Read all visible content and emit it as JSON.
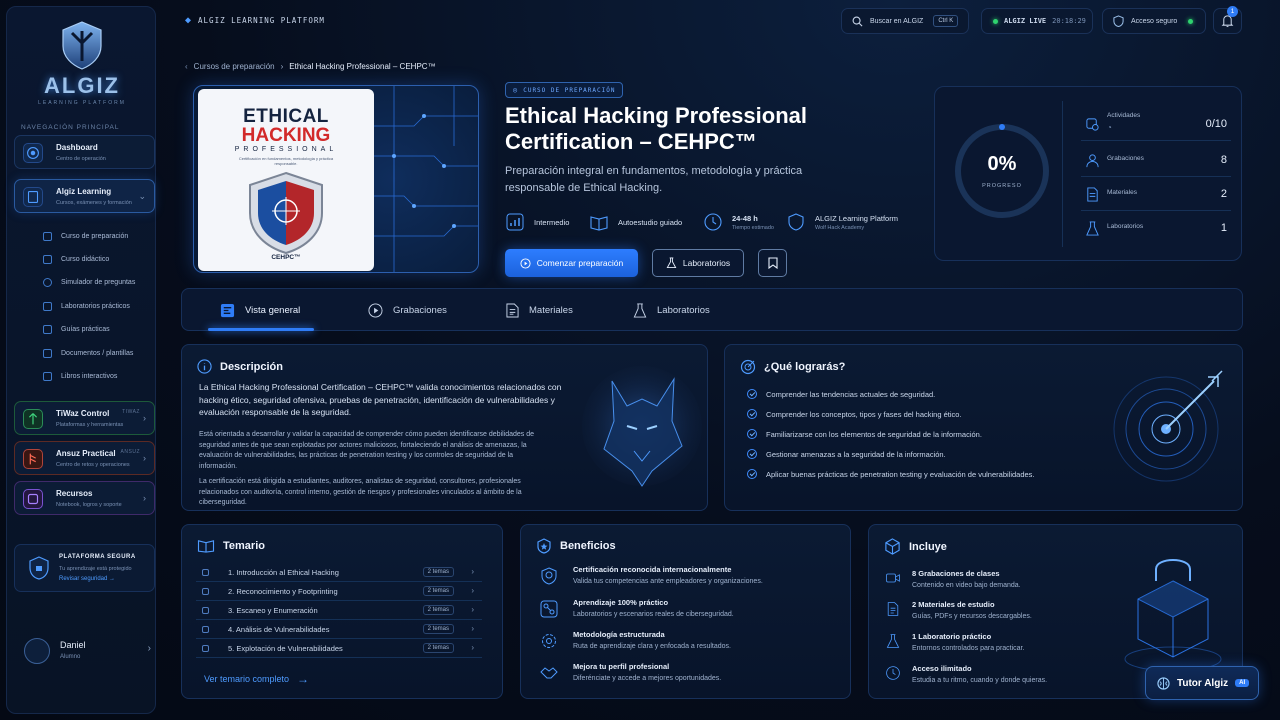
{
  "app": {
    "logo_text": "ALGIZ",
    "logo_sub": "LEARNING PLATFORM",
    "platform_label": "ALGIZ LEARNING PLATFORM"
  },
  "topbar": {
    "search_label": "Buscar en ALGIZ",
    "search_shortcut": "Ctrl K",
    "live_label": "ALGIZ LIVE",
    "live_time": "20:18:29",
    "secure_label": "Acceso seguro",
    "notifications_count": "1"
  },
  "sidebar": {
    "heading": "NAVEGACIÓN PRINCIPAL",
    "dashboard": {
      "title": "Dashboard",
      "subtitle": "Centro de operación"
    },
    "learning": {
      "title": "Algiz Learning",
      "subtitle": "Cursos, exámenes y formación"
    },
    "sub_items": [
      {
        "label": "Curso de preparación"
      },
      {
        "label": "Curso didáctico"
      },
      {
        "label": "Simulador de preguntas"
      },
      {
        "label": "Laboratorios prácticos"
      },
      {
        "label": "Guías prácticas"
      },
      {
        "label": "Documentos / plantillas"
      },
      {
        "label": "Libros interactivos"
      }
    ],
    "tiwaz": {
      "title": "TiWaz Control",
      "subtitle": "Plataformas y herramientas",
      "tag": "TIWAZ"
    },
    "ansuz": {
      "title": "Ansuz Practical",
      "subtitle": "Centro de retos y operaciones",
      "tag": "ANSUZ"
    },
    "recursos": {
      "title": "Recursos",
      "subtitle": "Notebook, logros y soporte"
    },
    "secure": {
      "title": "PLATAFORMA SEGURA",
      "subtitle": "Tu aprendizaje está protegido",
      "link": "Revisar seguridad"
    },
    "user": {
      "name": "Daniel",
      "role": "Alumno"
    }
  },
  "breadcrumb": {
    "parent": "Cursos de preparación",
    "current": "Ethical Hacking Professional – CEHPC™"
  },
  "book": {
    "title1": "ETHICAL",
    "title2": "HACKING",
    "title3": "PROFESSIONAL",
    "tagline": "Certificación en fundamentos, metodología y práctica responsable.",
    "code": "CEHPC™"
  },
  "course": {
    "tag": "CURSO DE PREPARACIÓN",
    "title": "Ethical Hacking Professional Certification – CEHPC™",
    "lead": "Preparación integral en fundamentos, metodología y práctica responsable de Ethical Hacking.",
    "level": "Intermedio",
    "mode": "Autoestudio guiado",
    "duration": "24-48 h",
    "duration_sub": "Tiempo estimado",
    "provider": "ALGIZ Learning Platform",
    "provider_sub": "Wolf Hack Academy",
    "cta_primary": "Comenzar preparación",
    "cta_labs": "Laboratorios"
  },
  "progress": {
    "percent_label": "0%",
    "percent_value": 0,
    "caption": "PROGRESO",
    "stats": [
      {
        "label": "Actividades",
        "value": "0/10"
      },
      {
        "label": "Grabaciones",
        "value": "8"
      },
      {
        "label": "Materiales",
        "value": "2"
      },
      {
        "label": "Laboratorios",
        "value": "1"
      }
    ]
  },
  "tabs": [
    {
      "label": "Vista general"
    },
    {
      "label": "Grabaciones"
    },
    {
      "label": "Materiales"
    },
    {
      "label": "Laboratorios"
    }
  ],
  "description": {
    "title": "Descripción",
    "bold": "La Ethical Hacking Professional Certification – CEHPC™ valida conocimientos relacionados con hacking ético, seguridad ofensiva, pruebas de penetración, identificación de vulnerabilidades y evaluación responsable de la seguridad.",
    "p1": "Está orientada a desarrollar y validar la capacidad de comprender cómo pueden identificarse debilidades de seguridad antes de que sean explotadas por actores maliciosos, fortaleciendo el análisis de amenazas, la evaluación de vulnerabilidades, las prácticas de penetration testing y los controles de seguridad de la información.",
    "p2": "La certificación está dirigida a estudiantes, auditores, analistas de seguridad, consultores, profesionales relacionados con auditoría, control interno, gestión de riesgos y profesionales vinculados al ámbito de la ciberseguridad."
  },
  "goals": {
    "title": "¿Qué lograrás?",
    "items": [
      "Comprender las tendencias actuales de seguridad.",
      "Comprender los conceptos, tipos y fases del hacking ético.",
      "Familiarizarse con los elementos de seguridad de la información.",
      "Gestionar amenazas a la seguridad de la información.",
      "Aplicar buenas prácticas de penetration testing y evaluación de vulnerabilidades."
    ]
  },
  "syllabus": {
    "title": "Temario",
    "items": [
      {
        "label": "1. Introducción al Ethical Hacking",
        "count": "2 temas"
      },
      {
        "label": "2. Reconocimiento y Footprinting",
        "count": "2 temas"
      },
      {
        "label": "3. Escaneo y Enumeración",
        "count": "2 temas"
      },
      {
        "label": "4. Análisis de Vulnerabilidades",
        "count": "2 temas"
      },
      {
        "label": "5. Explotación de Vulnerabilidades",
        "count": "2 temas"
      }
    ],
    "link": "Ver temario completo"
  },
  "benefits": {
    "title": "Beneficios",
    "items": [
      {
        "title": "Certificación reconocida internacionalmente",
        "desc": "Valida tus competencias ante empleadores y organizaciones."
      },
      {
        "title": "Aprendizaje 100% práctico",
        "desc": "Laboratorios y escenarios reales de ciberseguridad."
      },
      {
        "title": "Metodología estructurada",
        "desc": "Ruta de aprendizaje clara y enfocada a resultados."
      },
      {
        "title": "Mejora tu perfil profesional",
        "desc": "Diferénciate y accede a mejores oportunidades."
      }
    ]
  },
  "includes": {
    "title": "Incluye",
    "items": [
      {
        "title": "8  Grabaciones de clases",
        "desc": "Contenido en video bajo demanda."
      },
      {
        "title": "2   Materiales de estudio",
        "desc": "Guías, PDFs y recursos descargables."
      },
      {
        "title": "1  Laboratorio práctico",
        "desc": "Entornos controlados para practicar."
      },
      {
        "title": "Acceso ilimitado",
        "desc": "Estudia a tu ritmo, cuando y donde quieras."
      }
    ]
  },
  "tutor": {
    "label": "Tutor Algiz",
    "badge": "AI"
  },
  "colors": {
    "accent": "#2f7cf6",
    "bg": "#060d1c",
    "panel": "#0b1a33",
    "success": "#2fd36f",
    "danger": "#d22a2a"
  }
}
